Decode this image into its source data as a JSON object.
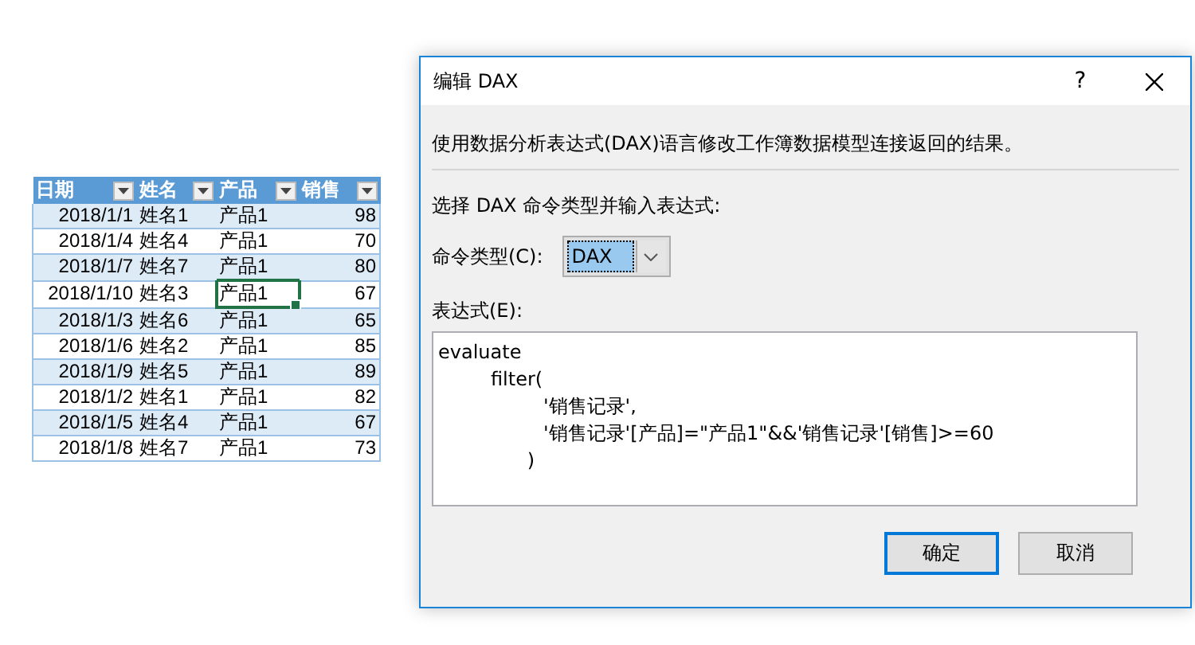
{
  "sheet": {
    "columns": [
      "日期",
      "姓名",
      "产品",
      "销售"
    ],
    "rows": [
      {
        "cells": [
          {
            "text": "2018/1/1",
            "selected": false
          },
          {
            "text": "姓名1",
            "selected": false
          },
          {
            "text": "产品1",
            "selected": false
          },
          {
            "text": "98",
            "selected": false
          }
        ]
      },
      {
        "cells": [
          {
            "text": "2018/1/4",
            "selected": false
          },
          {
            "text": "姓名4",
            "selected": false
          },
          {
            "text": "产品1",
            "selected": false
          },
          {
            "text": "70",
            "selected": false
          }
        ]
      },
      {
        "cells": [
          {
            "text": "2018/1/7",
            "selected": false
          },
          {
            "text": "姓名7",
            "selected": false
          },
          {
            "text": "产品1",
            "selected": false
          },
          {
            "text": "80",
            "selected": false
          }
        ]
      },
      {
        "cells": [
          {
            "text": "2018/1/10",
            "selected": false
          },
          {
            "text": "姓名3",
            "selected": false
          },
          {
            "text": "产品1",
            "selected": true
          },
          {
            "text": "67",
            "selected": false
          }
        ]
      },
      {
        "cells": [
          {
            "text": "2018/1/3",
            "selected": false
          },
          {
            "text": "姓名6",
            "selected": false
          },
          {
            "text": "产品1",
            "selected": false
          },
          {
            "text": "65",
            "selected": false
          }
        ]
      },
      {
        "cells": [
          {
            "text": "2018/1/6",
            "selected": false
          },
          {
            "text": "姓名2",
            "selected": false
          },
          {
            "text": "产品1",
            "selected": false
          },
          {
            "text": "85",
            "selected": false
          }
        ]
      },
      {
        "cells": [
          {
            "text": "2018/1/9",
            "selected": false
          },
          {
            "text": "姓名5",
            "selected": false
          },
          {
            "text": "产品1",
            "selected": false
          },
          {
            "text": "89",
            "selected": false
          }
        ]
      },
      {
        "cells": [
          {
            "text": "2018/1/2",
            "selected": false
          },
          {
            "text": "姓名1",
            "selected": false
          },
          {
            "text": "产品1",
            "selected": false
          },
          {
            "text": "82",
            "selected": false
          }
        ]
      },
      {
        "cells": [
          {
            "text": "2018/1/5",
            "selected": false
          },
          {
            "text": "姓名4",
            "selected": false
          },
          {
            "text": "产品1",
            "selected": false
          },
          {
            "text": "67",
            "selected": false
          }
        ]
      },
      {
        "cells": [
          {
            "text": "2018/1/8",
            "selected": false
          },
          {
            "text": "姓名7",
            "selected": false
          },
          {
            "text": "产品1",
            "selected": false
          },
          {
            "text": "73",
            "selected": false
          }
        ]
      }
    ]
  },
  "dialog": {
    "title": "编辑 DAX",
    "help": "?",
    "description": "使用数据分析表达式(DAX)语言修改工作簿数据模型连接返回的结果。",
    "instruction": "选择 DAX 命令类型并输入表达式:",
    "command_type": {
      "label": "命令类型(C):",
      "value": "DAX"
    },
    "expression": {
      "label": "表达式(E):",
      "value": "evaluate\n\tfilter(\n\t\t'销售记录',\n\t\t'销售记录'[产品]=\"产品1\"&&'销售记录'[销售]>=60\n\t      )"
    },
    "buttons": [
      {
        "label": "确定",
        "default": true
      },
      {
        "label": "取消",
        "default": false
      }
    ]
  }
}
